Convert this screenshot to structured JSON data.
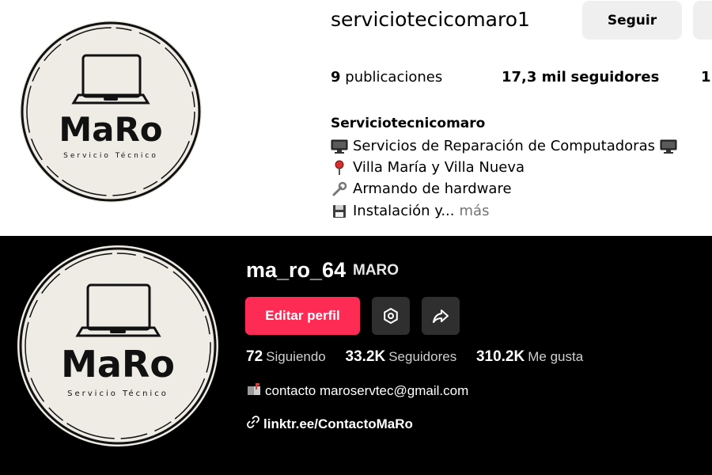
{
  "logo": {
    "wordmark": "MaRo",
    "tagline": "Servicio Técnico"
  },
  "instagram": {
    "username": "serviciotecicomaro1",
    "follow_label": "Seguir",
    "stats": {
      "posts_value": "9",
      "posts_label": "publicaciones",
      "followers_value": "17,3 mil",
      "followers_label": "seguidores",
      "following_partial": "1("
    },
    "bio": {
      "name": "Serviciotecnicomaro",
      "line1": "Servicios de Reparación de Computadoras",
      "line2": "Villa María y Villa Nueva",
      "line3": "Armando de hardware",
      "line4": "Instalación y...",
      "more": "más"
    },
    "icons": [
      "computer-icon",
      "pin-icon",
      "wrench-icon",
      "floppy-disk-icon"
    ]
  },
  "tiktok": {
    "handle": "ma_ro_64",
    "nickname": "MARO",
    "edit_label": "Editar perfil",
    "stats": {
      "following_value": "72",
      "following_label": "Siguiendo",
      "followers_value": "33.2K",
      "followers_label": "Seguidores",
      "likes_value": "310.2K",
      "likes_label": "Me gusta"
    },
    "contact": "contacto maroservtec@gmail.com",
    "link": "linktr.ee/ContactoMaRo",
    "icons": [
      "settings-icon",
      "share-icon",
      "mailbox-icon",
      "link-icon"
    ]
  },
  "colors": {
    "tiktok_accent": "#fe2c55",
    "tiktok_bg": "#000000",
    "ig_button_bg": "#efefef",
    "logo_bg": "#efece6"
  }
}
